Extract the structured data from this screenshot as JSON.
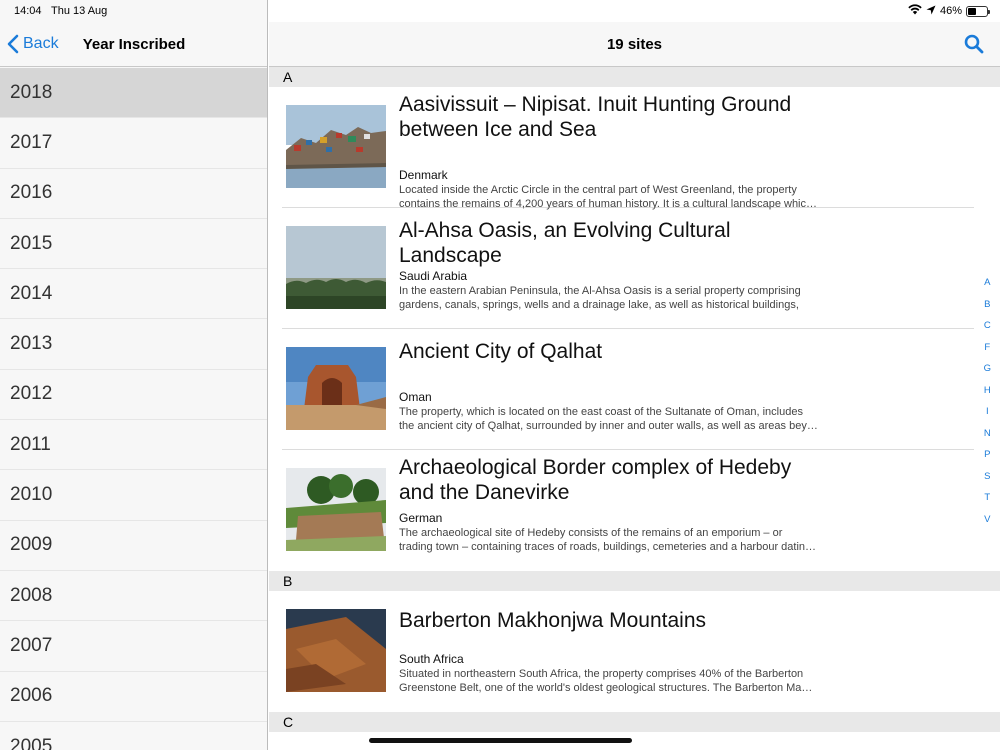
{
  "status": {
    "time": "14:04",
    "date": "Thu 13 Aug",
    "battery": "46%",
    "battery_level": 0.46
  },
  "sidebar": {
    "back_label": "Back",
    "title": "Year Inscribed",
    "years": [
      "2018",
      "2017",
      "2016",
      "2015",
      "2014",
      "2013",
      "2012",
      "2011",
      "2010",
      "2009",
      "2008",
      "2007",
      "2006",
      "2005"
    ],
    "selected_year": "2018"
  },
  "main": {
    "title": "19 sites",
    "sections": [
      {
        "letter": "A",
        "sites": [
          {
            "title": "Aasivissuit – Nipisat. Inuit Hunting Ground between Ice and Sea",
            "country": "Denmark",
            "desc": "Located inside the Arctic Circle in the central part of West Greenland, the property contains the remains of 4,200 years of human history. It is a cultural landscape whic…"
          },
          {
            "title": "Al-Ahsa Oasis, an Evolving Cultural Landscape",
            "country": "Saudi Arabia",
            "desc": "In the eastern Arabian Peninsula, the Al-Ahsa Oasis is a serial property comprising gardens, canals, springs, wells and a drainage lake, as well as historical buildings, u…"
          },
          {
            "title": "Ancient City of Qalhat",
            "country": "Oman",
            "desc": "The property, which is located on the east coast of the Sultanate of Oman, includes the ancient city of Qalhat, surrounded by inner and outer walls, as well as areas bey…"
          },
          {
            "title": "Archaeological Border complex of Hedeby and the Danevirke",
            "country": "German",
            "desc": "The archaeological site of Hedeby consists of the remains of an emporium – or trading town – containing traces of roads, buildings, cemeteries and a harbour datin…"
          }
        ]
      },
      {
        "letter": "B",
        "sites": [
          {
            "title": "Barberton Makhonjwa Mountains",
            "country": "South Africa",
            "desc": "Situated in northeastern South Africa, the property comprises 40% of the Barberton Greenstone Belt, one of the world's oldest geological structures. The Barberton Ma…"
          }
        ]
      },
      {
        "letter": "C",
        "sites": []
      }
    ],
    "index_letters": [
      "A",
      "B",
      "C",
      "F",
      "G",
      "H",
      "I",
      "N",
      "P",
      "S",
      "T",
      "V"
    ]
  },
  "colors": {
    "accent": "#1a7bd9",
    "selected_row": "#d6d6d6",
    "section_bg": "#e8e8e8"
  }
}
